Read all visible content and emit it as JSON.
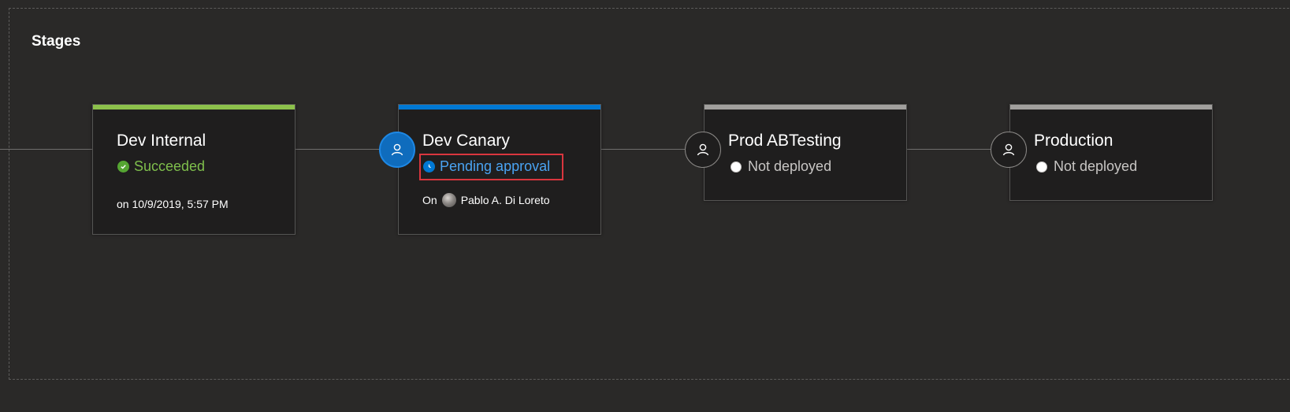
{
  "section": {
    "title": "Stages"
  },
  "colors": {
    "succeeded": "#7fbf4c",
    "pending": "#0078d4",
    "not_deployed": "#a19f9d",
    "highlight": "#d9363e"
  },
  "stages": [
    {
      "name": "Dev Internal",
      "status": "Succeeded",
      "status_icon": "check-circle-icon",
      "meta": "on 10/9/2019, 5:57 PM"
    },
    {
      "name": "Dev Canary",
      "status": "Pending approval",
      "status_icon": "clock-icon",
      "approver_icon": "person-icon",
      "meta_prefix": "On",
      "meta_user": "Pablo A. Di Loreto"
    },
    {
      "name": "Prod ABTesting",
      "status": "Not deployed",
      "status_icon": "empty-circle-icon",
      "approver_icon": "person-icon"
    },
    {
      "name": "Production",
      "status": "Not deployed",
      "status_icon": "empty-circle-icon",
      "approver_icon": "person-icon"
    }
  ]
}
